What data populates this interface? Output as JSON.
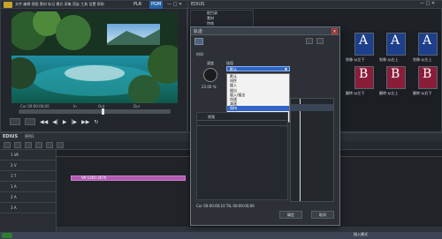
{
  "app": {
    "name": "EDIUS",
    "player_title": "PLR",
    "program_tag": "PGM"
  },
  "player": {
    "cue_timecode": "Cur 00:00:00;00",
    "in_label": "In",
    "out_label": "Out",
    "dur_label": "Dur"
  },
  "bin": {
    "title": "EDIUS",
    "tree_items": [
      "根目录",
      "素材",
      "特效"
    ],
    "clips": [
      {
        "letter": "A",
        "caption": "划像-从左下",
        "color": "#1d3f8c"
      },
      {
        "letter": "A",
        "caption": "划像-从右上",
        "color": "#1d3f8c"
      },
      {
        "letter": "A",
        "caption": "划像-从左上",
        "color": "#1d3f8c"
      },
      {
        "letter": "B",
        "caption": "翻转-从左下",
        "color": "#8a1e3a"
      },
      {
        "letter": "B",
        "caption": "翻转-从左上",
        "color": "#8a1e3a"
      },
      {
        "letter": "B",
        "caption": "翻转-从右下",
        "color": "#8a1e3a"
      }
    ]
  },
  "dialog": {
    "title": "轨道",
    "section_time": "时间",
    "knob_label": "速度",
    "knob_value": "23.00 %",
    "dropdown_label": "插值",
    "dropdown_value": "默认",
    "options": [
      "默认",
      "线性",
      "缓入",
      "缓出",
      "缓入/缓出",
      "加速",
      "减速",
      "保持",
      "其他"
    ],
    "selected_index": 7,
    "track_label": "视频",
    "time_readout": "Cur 00:00:00;10   TtL 00:00:00;00",
    "ok": "确定",
    "cancel": "取消"
  },
  "timeline": {
    "project": "EDIUS",
    "tab": "序列1",
    "tracks": [
      "1 VA",
      "2 V",
      "1 T",
      "1 A",
      "2 A",
      "3 A"
    ],
    "clip_label": "VA-1260-2676"
  },
  "taskbar": {
    "ime": "插入模式"
  }
}
